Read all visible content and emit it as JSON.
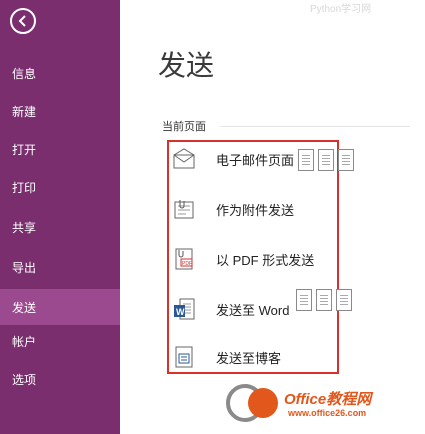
{
  "sidebar": {
    "back_icon": "back-arrow-icon",
    "items": [
      {
        "label": "信息",
        "active": false
      },
      {
        "label": "新建",
        "active": false
      },
      {
        "label": "打开",
        "active": false
      },
      {
        "label": "打印",
        "active": false
      },
      {
        "label": "共享",
        "active": false
      },
      {
        "label": "导出",
        "active": false
      },
      {
        "label": "发送",
        "active": true
      },
      {
        "label": "帐户",
        "active": false
      },
      {
        "label": "选项",
        "active": false
      }
    ],
    "bg_color": "#7a2e6e",
    "active_color": "#9c4a8f"
  },
  "main": {
    "faint_brand": "Python学习网",
    "title": "发送",
    "section_label": "当前页面",
    "options": [
      {
        "label": "电子邮件页面",
        "icon": "email-envelope-icon"
      },
      {
        "label": "作为附件发送",
        "icon": "attachment-icon"
      },
      {
        "label": "以 PDF 形式发送",
        "icon": "pdf-icon"
      },
      {
        "label": "发送至 Word",
        "icon": "word-icon"
      },
      {
        "label": "发送至博客",
        "icon": "blog-icon"
      }
    ],
    "highlight_color": "#d9302c"
  },
  "watermark": {
    "text": "Office教程网",
    "url": "www.office26.com"
  }
}
